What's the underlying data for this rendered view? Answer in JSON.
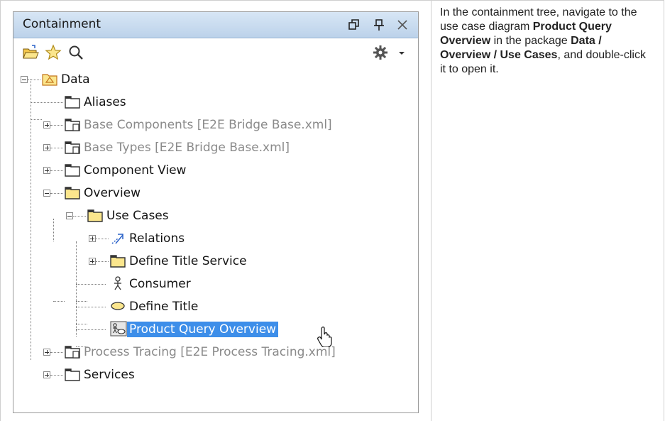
{
  "panel": {
    "title": "Containment"
  },
  "tree": {
    "root": "Data",
    "items": [
      {
        "label": "Aliases"
      },
      {
        "label": "Base Components [E2E Bridge Base.xml]"
      },
      {
        "label": "Base Types [E2E Bridge Base.xml]"
      },
      {
        "label": "Component View"
      },
      {
        "label": "Overview"
      },
      {
        "label": "Use Cases"
      },
      {
        "label": "Relations"
      },
      {
        "label": "Define Title Service"
      },
      {
        "label": "Consumer"
      },
      {
        "label": "Define Title"
      },
      {
        "label": "Product Query Overview"
      },
      {
        "label": "Process Tracing [E2E Process Tracing.xml]"
      },
      {
        "label": "Services"
      }
    ]
  },
  "instructions": {
    "t1": "In the containment tree, navigate to the use case diagram ",
    "b1": "Product Query Overview",
    "t2": " in the package ",
    "b2": "Data / Overview / Use Cases",
    "t3": ", and double-click it to open it."
  },
  "colors": {
    "selection": "#3d8ee9",
    "folder": "#fbe68d",
    "titlebar": "#c8dbef"
  }
}
